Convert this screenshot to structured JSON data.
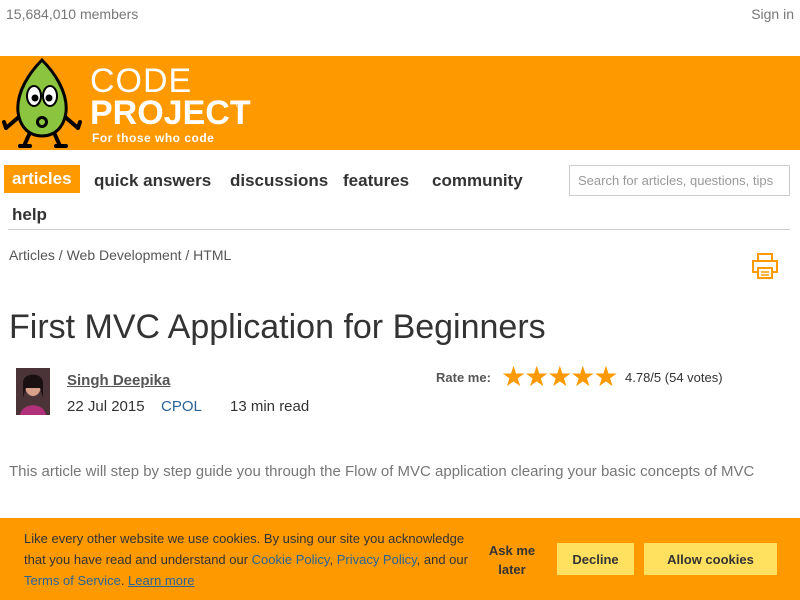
{
  "header": {
    "members": "15,684,010 members",
    "signin": "Sign in"
  },
  "logo": {
    "line1": "CODE",
    "line2": "PROJECT",
    "reg": "®",
    "tagline": "For those who code"
  },
  "nav": {
    "items": [
      {
        "label": "articles",
        "active": true
      },
      {
        "label": "quick answers"
      },
      {
        "label": "discussions"
      },
      {
        "label": "features"
      },
      {
        "label": "community"
      },
      {
        "label": "help"
      }
    ],
    "search_placeholder": "Search for articles, questions, tips"
  },
  "breadcrumb": {
    "items": [
      "Articles",
      "Web Development",
      "HTML"
    ],
    "separator": " / "
  },
  "article": {
    "title": "First MVC Application for Beginners",
    "author": "Singh Deepika",
    "date": "22 Jul 2015",
    "license": "CPOL",
    "read_time": "13 min read",
    "rate_label": "Rate me:",
    "stars": "★★★★★",
    "rating": "4.78/5 (54 votes)",
    "summary": "This article will step by step guide you through the Flow of MVC application clearing your basic concepts of MVC"
  },
  "cookie": {
    "text1": "Like every other website we use cookies. By using our site you acknowledge that you have read and understand our ",
    "cookie_policy": "Cookie Policy",
    "comma": ", ",
    "privacy_policy": "Privacy Policy",
    "and_our": ", and our ",
    "terms": "Terms of Service",
    "period": ". ",
    "learn_more": "Learn more",
    "ask_later": "Ask me later",
    "decline": "Decline",
    "allow": "Allow cookies"
  },
  "colors": {
    "brand_orange": "#FF9900",
    "button_yellow": "#FFE05F",
    "link_blue": "#2a6496",
    "mascot_green": "#8BC53F"
  }
}
